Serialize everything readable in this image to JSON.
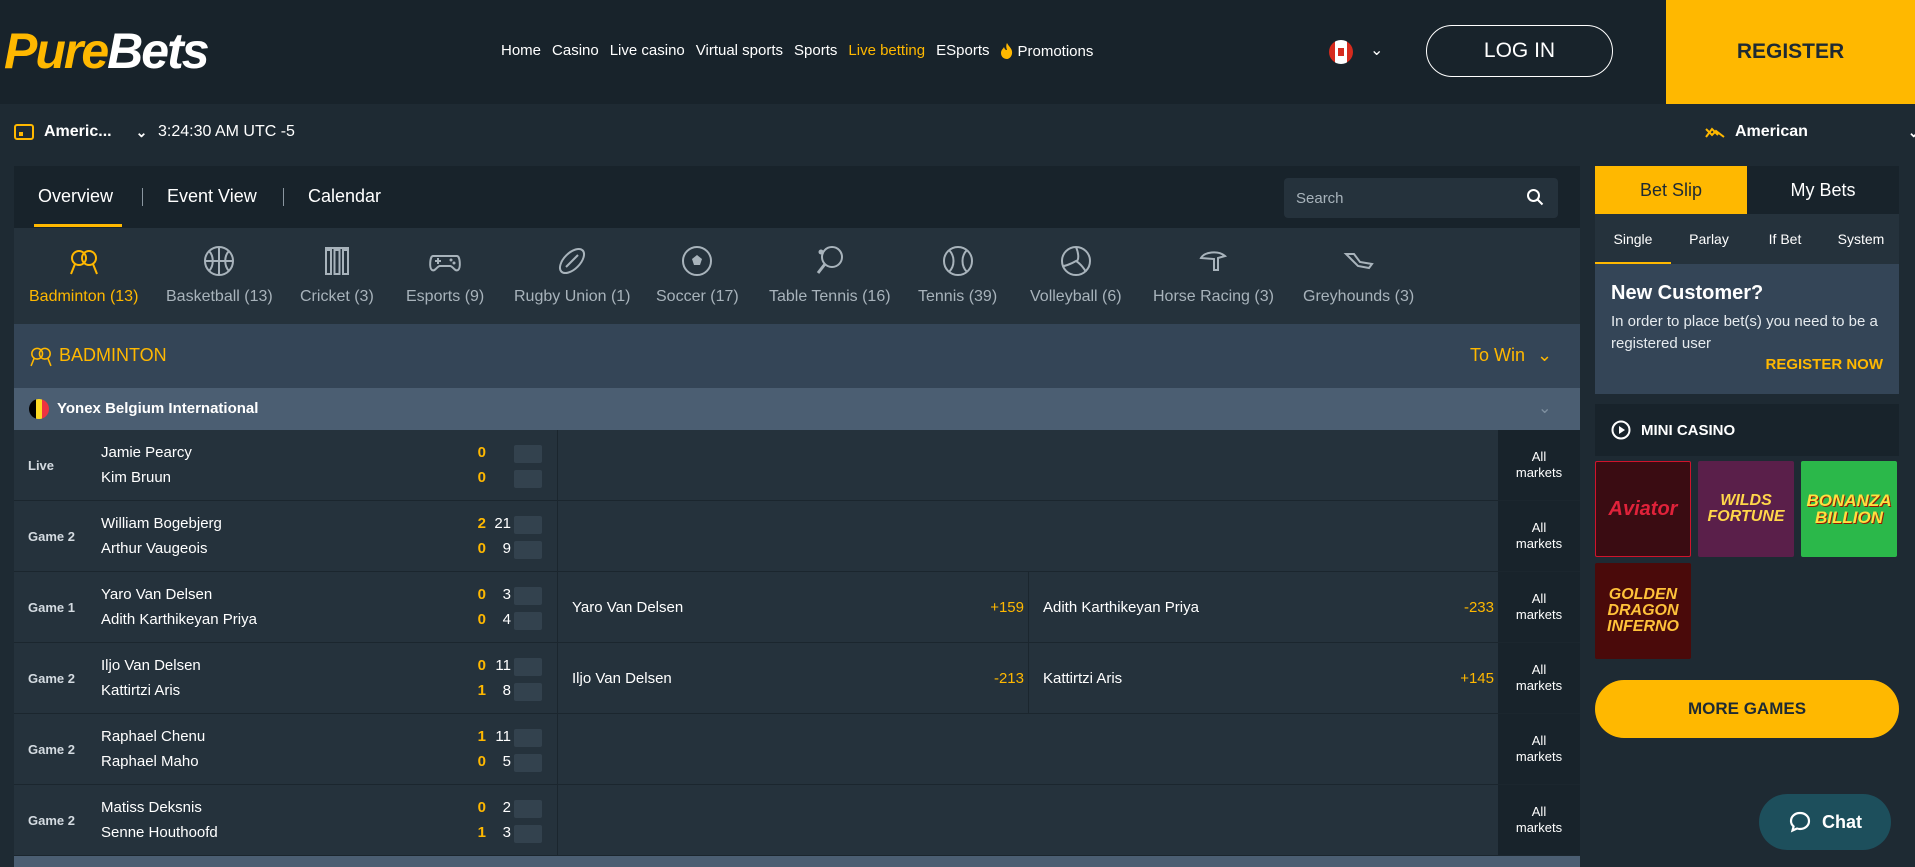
{
  "header": {
    "logo_pure": "Pure",
    "logo_bets": "Bets",
    "nav": [
      "Home",
      "Casino",
      "Live casino",
      "Virtual sports",
      "Sports",
      "Live betting",
      "ESports"
    ],
    "nav_active": "Live betting",
    "promotions": "Promotions",
    "login": "LOG IN",
    "register": "REGISTER"
  },
  "subbar": {
    "odds_left": "Americ...",
    "clock": "3:24:30 AM UTC -5",
    "odds_right": "American"
  },
  "tabs": {
    "overview": "Overview",
    "event_view": "Event View",
    "calendar": "Calendar",
    "search_placeholder": "Search"
  },
  "sports": [
    {
      "label": "Badminton (13)",
      "icon": "badminton-icon"
    },
    {
      "label": "Basketball (13)",
      "icon": "basketball-icon"
    },
    {
      "label": "Cricket (3)",
      "icon": "cricket-icon"
    },
    {
      "label": "Esports (9)",
      "icon": "gamepad-icon"
    },
    {
      "label": "Rugby Union (1)",
      "icon": "rugby-ball-icon"
    },
    {
      "label": "Soccer (17)",
      "icon": "soccer-ball-icon"
    },
    {
      "label": "Table Tennis (16)",
      "icon": "table-tennis-icon"
    },
    {
      "label": "Tennis (39)",
      "icon": "tennis-ball-icon"
    },
    {
      "label": "Volleyball (6)",
      "icon": "volleyball-icon"
    },
    {
      "label": "Horse Racing (3)",
      "icon": "horse-racing-icon"
    },
    {
      "label": "Greyhounds (3)",
      "icon": "greyhound-icon"
    }
  ],
  "section": {
    "title": "BADMINTON",
    "market": "To Win"
  },
  "league": {
    "name": "Yonex Belgium International",
    "flag_colors": [
      "#000000",
      "#fdda24",
      "#ef3340"
    ]
  },
  "matches": [
    {
      "period": "Live",
      "p1": "Jamie Pearcy",
      "p2": "Kim Bruun",
      "s1a": "0",
      "s1b": "",
      "s2a": "0",
      "s2b": "",
      "odds": null
    },
    {
      "period": "Game 2",
      "p1": "William Bogebjerg",
      "p2": "Arthur Vaugeois",
      "s1a": "2",
      "s1b": "21",
      "s2a": "0",
      "s2b": "9",
      "odds": null
    },
    {
      "period": "Game 1",
      "p1": "Yaro Van Delsen",
      "p2": "Adith Karthikeyan Priya",
      "s1a": "0",
      "s1b": "3",
      "s2a": "0",
      "s2b": "4",
      "odds": {
        "home": "Yaro Van Delsen",
        "home_odds": "+159",
        "away": "Adith Karthikeyan Priya",
        "away_odds": "-233"
      }
    },
    {
      "period": "Game 2",
      "p1": "Iljo Van Delsen",
      "p2": "Kattirtzi Aris",
      "s1a": "0",
      "s1b": "11",
      "s2a": "1",
      "s2b": "8",
      "odds": {
        "home": "Iljo Van Delsen",
        "home_odds": "-213",
        "away": "Kattirtzi Aris",
        "away_odds": "+145"
      }
    },
    {
      "period": "Game 2",
      "p1": "Raphael Chenu",
      "p2": "Raphael Maho",
      "s1a": "1",
      "s1b": "11",
      "s2a": "0",
      "s2b": "5",
      "odds": null
    },
    {
      "period": "Game 2",
      "p1": "Matiss Deksnis",
      "p2": "Senne Houthoofd",
      "s1a": "0",
      "s1b": "2",
      "s2a": "1",
      "s2b": "3",
      "odds": null
    }
  ],
  "all_markets": "All markets",
  "betslip": {
    "tab_active": "Bet Slip",
    "tab_other": "My Bets",
    "types": [
      "Single",
      "Parlay",
      "If Bet",
      "System"
    ],
    "new_customer_title": "New Customer?",
    "new_customer_text": "In order to place bet(s) you need to be a registered user",
    "register_now": "REGISTER NOW",
    "mini_casino": "MINI CASINO",
    "games": [
      "Aviator",
      "WILDS FORTUNE",
      "BONANZA BILLION",
      "GOLDEN DRAGON INFERNO"
    ],
    "more_games": "MORE GAMES"
  },
  "chat": "Chat",
  "colors": {
    "accent": "#ffb800",
    "bg": "#1e2a33",
    "panel": "#25323c",
    "header": "#18232b"
  }
}
